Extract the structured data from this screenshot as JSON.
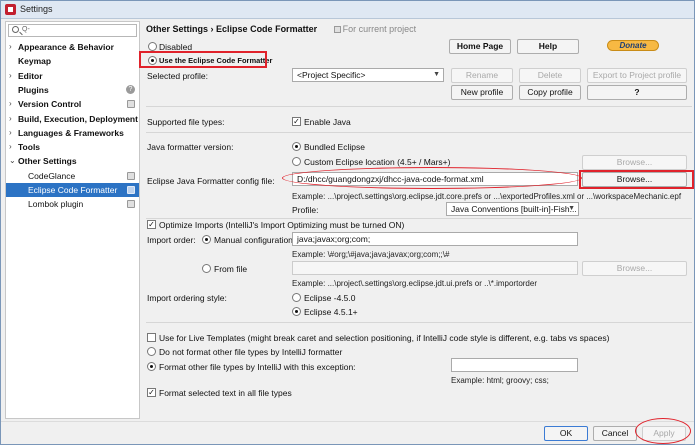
{
  "window": {
    "title": "Settings"
  },
  "sidebar": {
    "search_caret": "Q-",
    "items": [
      {
        "label": "Appearance & Behavior",
        "arrow": "›",
        "bold": true
      },
      {
        "label": "Keymap",
        "arrow": "",
        "bold": true
      },
      {
        "label": "Editor",
        "arrow": "›",
        "bold": true
      },
      {
        "label": "Plugins",
        "arrow": "",
        "bold": true
      },
      {
        "label": "Version Control",
        "arrow": "›",
        "bold": true
      },
      {
        "label": "Build, Execution, Deployment",
        "arrow": "›",
        "bold": true
      },
      {
        "label": "Languages & Frameworks",
        "arrow": "›",
        "bold": true
      },
      {
        "label": "Tools",
        "arrow": "›",
        "bold": true
      },
      {
        "label": "Other Settings",
        "arrow": "⌄",
        "bold": true
      },
      {
        "label": "CodeGlance",
        "child": true
      },
      {
        "label": "Eclipse Code Formatter",
        "child": true,
        "selected": true
      },
      {
        "label": "Lombok plugin",
        "child": true
      }
    ]
  },
  "breadcrumb": {
    "parent": "Other Settings",
    "separator": "›",
    "current": "Eclipse Code Formatter",
    "for_project": "For current project"
  },
  "top_buttons": {
    "home_page": "Home Page",
    "help": "Help",
    "donate": "Donate"
  },
  "mode": {
    "disabled": "Disabled",
    "use": "Use the Eclipse Code Formatter"
  },
  "profile": {
    "label": "Selected profile:",
    "value": "<Project Specific>",
    "rename": "Rename",
    "delete": "Delete",
    "export": "Export to Project profile",
    "new": "New profile",
    "copy": "Copy profile",
    "help": "?"
  },
  "supported": {
    "label": "Supported file types:",
    "enable_java": "Enable Java"
  },
  "java_version": {
    "label": "Java formatter version:",
    "bundled": "Bundled Eclipse",
    "custom": "Custom Eclipse location (4.5+ / Mars+)",
    "browse_disabled": "Browse..."
  },
  "config": {
    "label": "Eclipse Java Formatter config file:",
    "value": "D:/dhcc/guangdongzxj/dhcc-java-code-format.xml",
    "browse": "Browse...",
    "example": "Example: ...\\project\\.settings\\org.eclipse.jdt.core.prefs or ...\\exportedProfiles.xml or ...\\workspaceMechanic.epf",
    "profile_label": "Profile:",
    "profile_value": "Java Conventions [built-in]-Fish..."
  },
  "imports": {
    "optimize": "Optimize Imports  (IntelliJ's Import Optimizing must be turned ON)",
    "order_label": "Import order:",
    "manual": "Manual configuration",
    "manual_value": "java;javax;org;com;",
    "manual_example": "Example: \\#org;\\#java;java;javax;org;com;;\\#",
    "from_file": "From file",
    "from_file_browse": "Browse...",
    "from_file_example": "Example: ...\\project\\.settings\\org.eclipse.jdt.ui.prefs or ..\\*.importorder",
    "style_label": "Import ordering style:",
    "style_450": "Eclipse -4.5.0",
    "style_451": "Eclipse 4.5.1+"
  },
  "other": {
    "live_templates": "Use for Live Templates (might break caret and selection positioning, if IntelliJ code style is different, e.g. tabs vs spaces)",
    "do_not_format": "Do not format other file types by IntelliJ formatter",
    "format_other": "Format other file types by IntelliJ with this exception:",
    "format_other_example": "Example: html; groovy; css;",
    "format_selected": "Format selected text in all file types"
  },
  "footer": {
    "ok": "OK",
    "cancel": "Cancel",
    "apply": "Apply"
  }
}
